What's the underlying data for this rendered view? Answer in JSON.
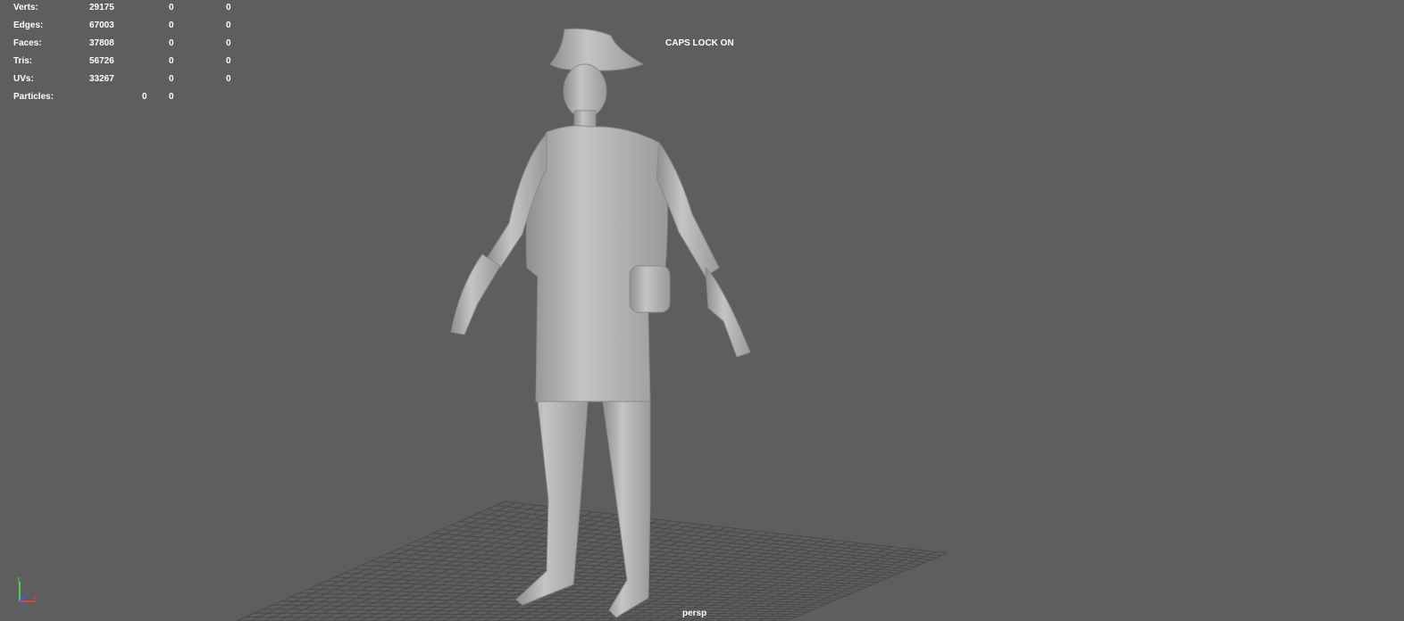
{
  "hud": {
    "rows": [
      {
        "label": "Verts:",
        "v1": "29175",
        "v2": "0",
        "v3": "0"
      },
      {
        "label": "Edges:",
        "v1": "67003",
        "v2": "0",
        "v3": "0"
      },
      {
        "label": "Faces:",
        "v1": "37808",
        "v2": "0",
        "v3": "0"
      },
      {
        "label": "Tris:",
        "v1": "56726",
        "v2": "0",
        "v3": "0"
      },
      {
        "label": "UVs:",
        "v1": "33267",
        "v2": "0",
        "v3": "0"
      }
    ],
    "particles": {
      "label": "Particles:",
      "v1": "0",
      "v2": "0"
    }
  },
  "status": {
    "caps_lock": "CAPS LOCK ON"
  },
  "camera": {
    "name": "persp"
  },
  "axis_indicator": {
    "x": "x",
    "y": "y",
    "z": "z"
  },
  "colors": {
    "background": "#5e5e5e",
    "grid": "#4a4a4a",
    "model": "#b9b9b9"
  }
}
